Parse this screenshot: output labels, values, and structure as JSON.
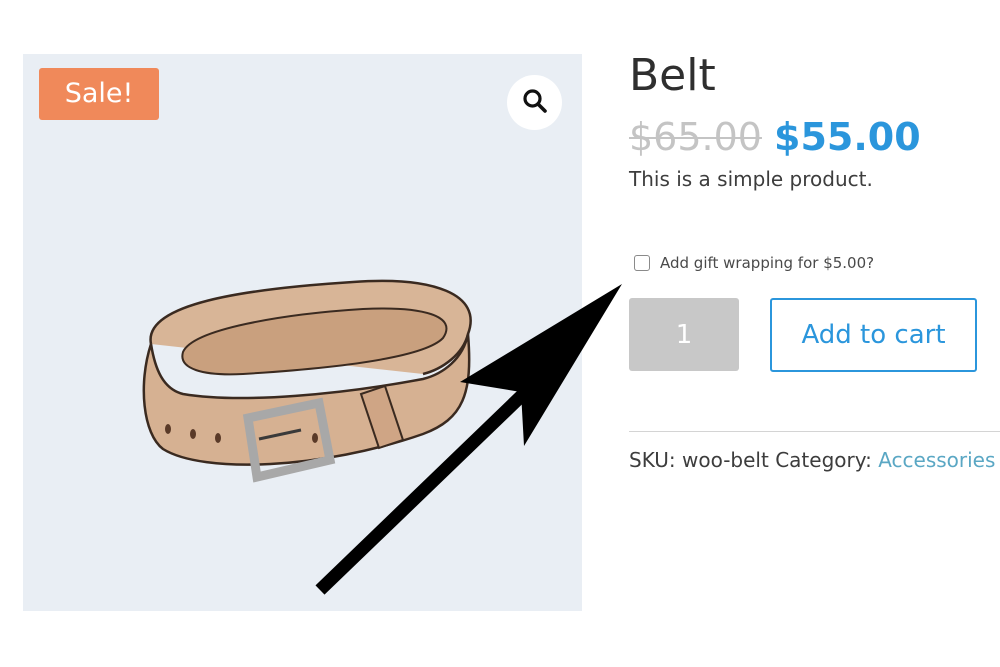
{
  "gallery": {
    "sale_badge": "Sale!",
    "zoom_icon": "search-icon",
    "image_subject": "belt"
  },
  "product": {
    "title": "Belt",
    "regular_price": "$65.00",
    "sale_price": "$55.00",
    "short_description": "This is a simple product."
  },
  "gift_option": {
    "label": "Add gift wrapping for $5.00?",
    "checked": false
  },
  "cart": {
    "quantity": "1",
    "add_to_cart_label": "Add to cart"
  },
  "meta": {
    "sku_label": "SKU:",
    "sku_value": "woo-belt",
    "category_label": "Category:",
    "category_value": "Accessories"
  },
  "colors": {
    "accent": "#2b96dc",
    "sale_badge": "#f0895a",
    "gallery_bg": "#e9eef4",
    "link": "#5aa7c4"
  },
  "annotation": {
    "arrow_icon": "arrow-icon"
  }
}
